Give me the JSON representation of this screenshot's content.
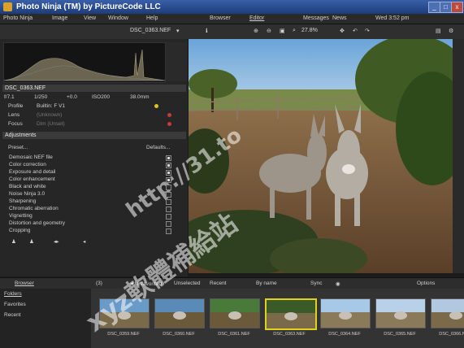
{
  "window": {
    "title": "Photo Ninja (TM) by PictureCode LLC",
    "min": "_",
    "max": "□",
    "close": "x"
  },
  "menu": {
    "items": [
      "Photo Ninja",
      "Image",
      "View",
      "Window",
      "Help"
    ],
    "center": [
      "Browser",
      "Editor"
    ],
    "right": [
      "Messages",
      "News"
    ],
    "datetime": "Wed 3:52 pm"
  },
  "toolbar": {
    "filename": "DSC_0363.NEF",
    "zoom": "27.8%"
  },
  "info": {
    "name": "DSC_0363.NEF",
    "exposure": [
      "f/7.1",
      "1/250",
      "+0.0",
      "ISO200",
      "38.0mm"
    ],
    "profile_label": "Profile",
    "profile_value": "Builtin: F V1",
    "lens_label": "Lens",
    "lens_value": "(Unknown)",
    "focus_label": "Focus",
    "focus_value": "Dim (Unset)"
  },
  "adjustments": {
    "header": "Adjustments",
    "preset_label": "Preset...",
    "defaults_label": "Defaults...",
    "items": [
      {
        "label": "Demosaic NEF file",
        "on": true
      },
      {
        "label": "Color correction",
        "on": true
      },
      {
        "label": "Exposure and detail",
        "on": true
      },
      {
        "label": "Color enhancement",
        "on": true
      },
      {
        "label": "Black and white",
        "on": false
      },
      {
        "label": "Noise Ninja 3.0",
        "on": false
      },
      {
        "label": "Sharpening",
        "on": false
      },
      {
        "label": "Chromatic aberration",
        "on": false
      },
      {
        "label": "Vignetting",
        "on": false
      },
      {
        "label": "Distortion and geometry",
        "on": false
      },
      {
        "label": "Cropping",
        "on": false
      }
    ]
  },
  "browser": {
    "tab": "Browser",
    "stars": "Recent",
    "filter": "★Unfavorited",
    "sort_by": "By name",
    "sync": "Sync",
    "options": "Options",
    "filter_count": "(3)",
    "unselected": "Unselected"
  },
  "folders": [
    "Folders",
    "Favorites",
    "Recent"
  ],
  "thumbnails": [
    {
      "label": "DSC_0359.NEF",
      "selected": false
    },
    {
      "label": "DSC_0360.NEF",
      "selected": false
    },
    {
      "label": "DSC_0361.NEF",
      "selected": false
    },
    {
      "label": "DSC_0363.NEF",
      "selected": true
    },
    {
      "label": "DSC_0364.NEF",
      "selected": false
    },
    {
      "label": "DSC_0365.NEF",
      "selected": false
    },
    {
      "label": "DSC_0366.NEF",
      "selected": false
    }
  ],
  "watermark": {
    "url": "http://31.to",
    "cjk": "xyz軟體補給站"
  },
  "colors": {
    "accent": "#e0d21c",
    "titlebar": "#2a4b95",
    "panel": "#262626"
  }
}
